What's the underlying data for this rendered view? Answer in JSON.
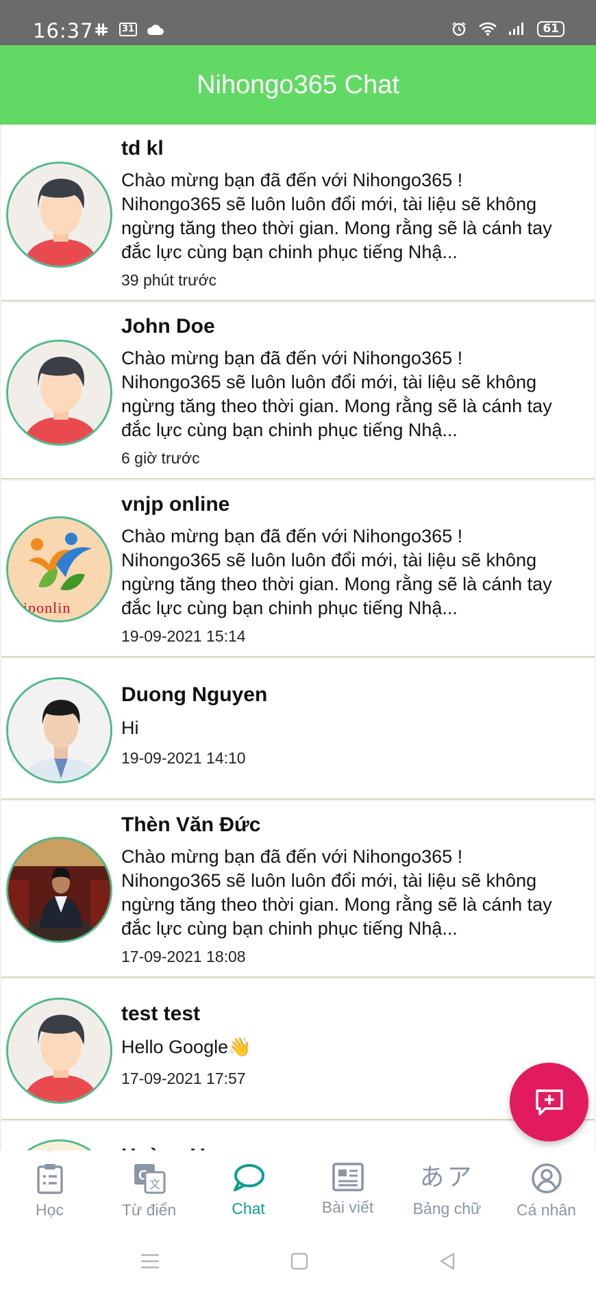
{
  "status_bar": {
    "time": "16:37",
    "calendar_day": "31",
    "battery": "61"
  },
  "header": {
    "title": "Nihongo365 Chat"
  },
  "conversations": [
    {
      "name": "td kl",
      "message": "Chào mừng bạn đã đến với Nihongo365 ! Nihongo365 sẽ luôn luôn đổi mới, tài liệu sẽ không ngừng tăng theo thời gian. Mong rằng sẽ là cánh tay đắc lực cùng bạn chinh phục tiếng Nhậ...",
      "time": "39 phút trước",
      "avatar": "default-avatar"
    },
    {
      "name": "John Doe",
      "message": "Chào mừng bạn đã đến với Nihongo365 ! Nihongo365 sẽ luôn luôn đổi mới, tài liệu sẽ không ngừng tăng theo thời gian. Mong rằng sẽ là cánh tay đắc lực cùng bạn chinh phục tiếng Nhậ...",
      "time": "6 giờ trước",
      "avatar": "default-avatar"
    },
    {
      "name": "vnjp online",
      "message": "Chào mừng bạn đã đến với Nihongo365 ! Nihongo365 sẽ luôn luôn đổi mới, tài liệu sẽ không ngừng tăng theo thời gian. Mong rằng sẽ là cánh tay đắc lực cùng bạn chinh phục tiếng Nhậ...",
      "time": "19-09-2021 15:14",
      "avatar": "logo-avatar",
      "logo_text": "niponlin"
    },
    {
      "name": "Duong Nguyen",
      "message": "Hi",
      "time": "19-09-2021 14:10",
      "avatar": "photo-avatar"
    },
    {
      "name": "Thèn Văn Đức",
      "message": "Chào mừng bạn đã đến với Nihongo365 ! Nihongo365 sẽ luôn luôn đổi mới, tài liệu sẽ không ngừng tăng theo thời gian. Mong rằng sẽ là cánh tay đắc lực cùng bạn chinh phục tiếng Nhậ...",
      "time": "17-09-2021 18:08",
      "avatar": "photo-avatar"
    },
    {
      "name": "test test",
      "message": "Hello Google👋",
      "time": "17-09-2021 17:57",
      "avatar": "default-avatar"
    },
    {
      "name": "Hoàng V",
      "avatar": "logo-avatar"
    }
  ],
  "tabs": [
    {
      "label": "Học",
      "icon": "clipboard-list-icon",
      "active": false
    },
    {
      "label": "Từ điển",
      "icon": "translate-icon",
      "active": false
    },
    {
      "label": "Chat",
      "icon": "chat-bubble-icon",
      "active": true
    },
    {
      "label": "Bài viết",
      "icon": "article-icon",
      "active": false
    },
    {
      "label": "Bảng chữ",
      "icon": "kana-icon",
      "kana": "あア",
      "active": false
    },
    {
      "label": "Cá nhân",
      "icon": "user-circle-icon",
      "active": false
    }
  ],
  "fab": {
    "icon": "new-message-icon"
  },
  "colors": {
    "header": "#61d964",
    "accent": "#0f9d8f",
    "fab": "#e21b5f",
    "inactive": "#8b96a5"
  }
}
